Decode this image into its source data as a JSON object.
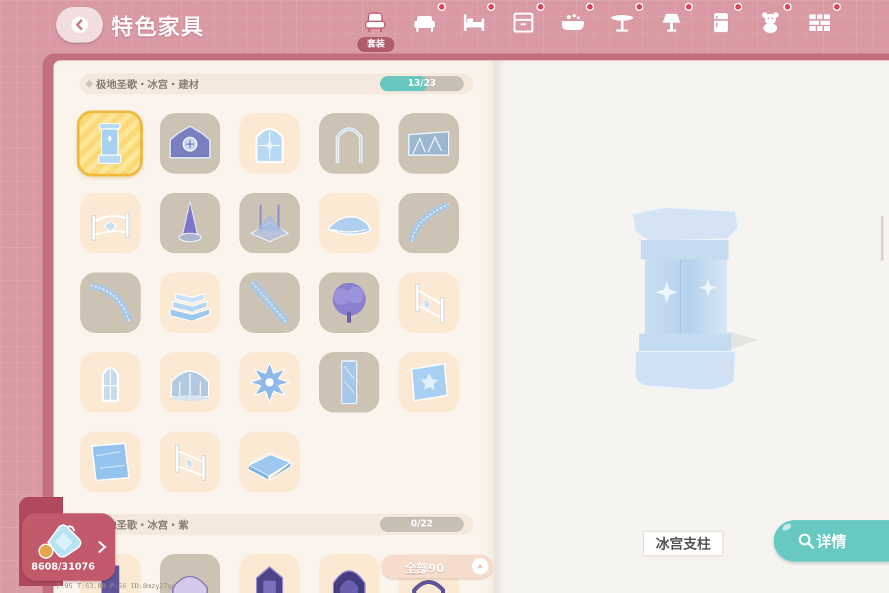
{
  "header": {
    "title": "特色家具",
    "active_tab_label": "套装",
    "tabs": [
      {
        "icon": "armchair-icon",
        "active": true,
        "dot": false
      },
      {
        "icon": "sofa-icon",
        "active": false,
        "dot": true
      },
      {
        "icon": "bed-icon",
        "active": false,
        "dot": true
      },
      {
        "icon": "cabinet-icon",
        "active": false,
        "dot": true
      },
      {
        "icon": "bathtub-icon",
        "active": false,
        "dot": true
      },
      {
        "icon": "table-icon",
        "active": false,
        "dot": true
      },
      {
        "icon": "lamp-icon",
        "active": false,
        "dot": true
      },
      {
        "icon": "fridge-icon",
        "active": false,
        "dot": true
      },
      {
        "icon": "teddy-bear-icon",
        "active": false,
        "dot": true
      },
      {
        "icon": "brick-wall-icon",
        "active": false,
        "dot": true
      }
    ]
  },
  "sections": [
    {
      "title": "极地圣歌・冰宫・建材",
      "progress_text": "13/23",
      "progress_fraction": 0.565,
      "items": [
        {
          "icon": "ice-pillar-icon",
          "state": "selected"
        },
        {
          "icon": "ice-gate-icon",
          "state": "owned"
        },
        {
          "icon": "ice-window-icon",
          "state": "unowned"
        },
        {
          "icon": "gothic-arch-icon",
          "state": "owned"
        },
        {
          "icon": "ice-wall-icon",
          "state": "owned"
        },
        {
          "icon": "ice-fence-icon",
          "state": "unowned"
        },
        {
          "icon": "ice-spire-icon",
          "state": "owned"
        },
        {
          "icon": "ice-tent-icon",
          "state": "owned"
        },
        {
          "icon": "ice-floor-mound-icon",
          "state": "unowned"
        },
        {
          "icon": "curved-stairs-icon",
          "state": "owned"
        },
        {
          "icon": "spiral-stairs-icon",
          "state": "owned"
        },
        {
          "icon": "ice-steps-icon",
          "state": "unowned"
        },
        {
          "icon": "straight-stairs-icon",
          "state": "owned"
        },
        {
          "icon": "purple-tree-icon",
          "state": "owned"
        },
        {
          "icon": "fence-corner-icon",
          "state": "unowned"
        },
        {
          "icon": "arched-window-icon",
          "state": "unowned"
        },
        {
          "icon": "ice-dome-icon",
          "state": "unowned"
        },
        {
          "icon": "snowflake-icon",
          "state": "unowned"
        },
        {
          "icon": "ice-mirror-icon",
          "state": "owned"
        },
        {
          "icon": "ice-tile-icon",
          "state": "unowned"
        },
        {
          "icon": "ice-floor-tile-icon",
          "state": "unowned"
        },
        {
          "icon": "ice-railing-icon",
          "state": "unowned"
        },
        {
          "icon": "ice-platform-icon",
          "state": "unowned"
        }
      ]
    },
    {
      "title": "极地圣歌・冰宫・紫",
      "progress_text": "0/22",
      "progress_fraction": 0,
      "items": [
        {
          "icon": "purple-pillar-icon",
          "state": "unowned"
        },
        {
          "icon": "purple-dome-icon",
          "state": "owned"
        },
        {
          "icon": "purple-cabinet-icon",
          "state": "unowned"
        },
        {
          "icon": "purple-throne-icon",
          "state": "unowned"
        },
        {
          "icon": "purple-arch-icon",
          "state": "unowned"
        }
      ]
    }
  ],
  "preview": {
    "item_name": "冰宫支柱",
    "detail_label": "详情"
  },
  "filter": {
    "label": "全部90"
  },
  "currency": {
    "amount": "8608/31076"
  },
  "debug": {
    "text": "P:95  T:63.80  P:56  ID:8mzy27gy"
  }
}
